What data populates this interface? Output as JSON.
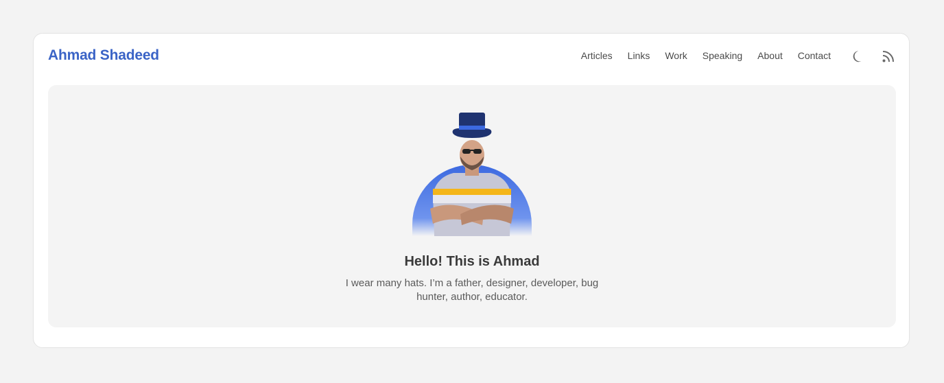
{
  "site": {
    "brand": "Ahmad Shadeed"
  },
  "nav": {
    "items": [
      {
        "label": "Articles"
      },
      {
        "label": "Links"
      },
      {
        "label": "Work"
      },
      {
        "label": "Speaking"
      },
      {
        "label": "About"
      },
      {
        "label": "Contact"
      }
    ]
  },
  "icons": {
    "theme_toggle": "moon-icon",
    "feed": "rss-icon"
  },
  "hero": {
    "title": "Hello! This is Ahmad",
    "description": "I wear many hats. I’m a father, designer, developer, bug hunter, author, educator."
  },
  "colors": {
    "brand": "#3a63c6",
    "page_bg": "#f3f3f3",
    "card_bg": "#ffffff",
    "hero_bg": "#f4f4f4"
  }
}
